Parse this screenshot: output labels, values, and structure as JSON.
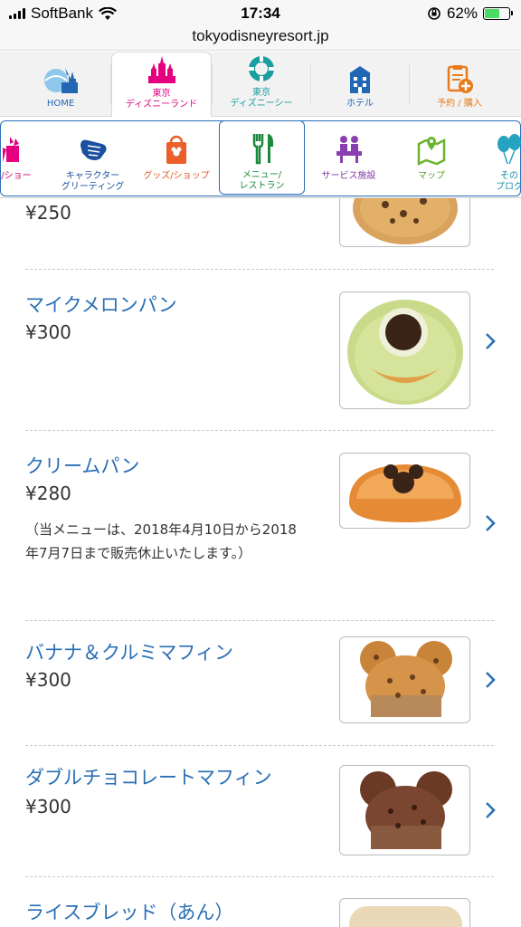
{
  "status_bar": {
    "carrier": "SoftBank",
    "time": "17:34",
    "battery": "62%",
    "battery_level": 0.62
  },
  "url_bar": {
    "url": "tokyodisneyresort.jp"
  },
  "top_nav": {
    "items": [
      {
        "label": "HOME",
        "icon": "castle-globe-icon"
      },
      {
        "label": "東京\nディズニーランド",
        "icon": "castle-icon"
      },
      {
        "label": "東京\nディズニーシー",
        "icon": "lifebuoy-icon"
      },
      {
        "label": "ホテル",
        "icon": "hotel-icon"
      },
      {
        "label": "予約 / 購入",
        "icon": "reservation-icon"
      }
    ]
  },
  "category_nav": {
    "items": [
      {
        "label": "ド/ショー",
        "icon": "parade-icon"
      },
      {
        "label": "キャラクター\nグリーティング",
        "icon": "glove-icon"
      },
      {
        "label": "グッズ/ショップ",
        "icon": "shopping-bag-icon"
      },
      {
        "label": "メニュー/\nレストラン",
        "icon": "fork-knife-icon"
      },
      {
        "label": "サービス施設",
        "icon": "service-icon"
      },
      {
        "label": "マップ",
        "icon": "map-icon"
      },
      {
        "label": "その\nプログ",
        "icon": "balloon-icon"
      }
    ]
  },
  "menu": {
    "items": [
      {
        "name": "",
        "price": "¥250",
        "note": "",
        "image": "cookie-bread"
      },
      {
        "name": "マイクメロンパン",
        "price": "¥300",
        "note": "",
        "image": "mike-melon-pan"
      },
      {
        "name": "クリームパン",
        "price": "¥280",
        "note": "（当メニューは、2018年4月10日から2018年7月7日まで販売休止いたします。）",
        "image": "cream-pan"
      },
      {
        "name": "バナナ＆クルミマフィン",
        "price": "¥300",
        "note": "",
        "image": "banana-walnut-muffin"
      },
      {
        "name": "ダブルチョコレートマフィン",
        "price": "¥300",
        "note": "",
        "image": "double-chocolate-muffin"
      },
      {
        "name": "ライスブレッド（あん）",
        "price": "",
        "note": "",
        "image": "rice-bread"
      }
    ]
  },
  "colors": {
    "link": "#2a6fb5",
    "land_pink": "#e4007f",
    "sea_teal": "#1a9ea0",
    "hotel_blue": "#2267b4",
    "reserve_orange": "#ea7a1a"
  }
}
